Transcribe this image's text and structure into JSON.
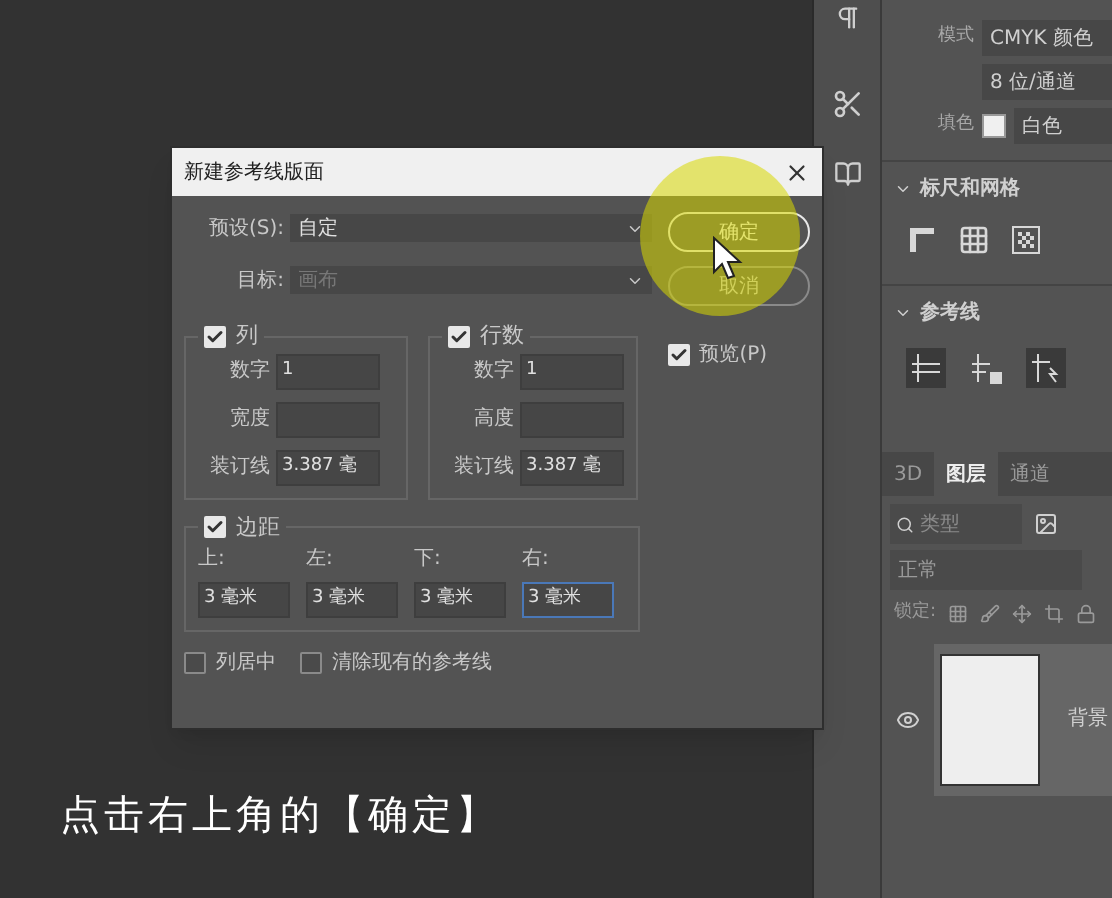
{
  "dialog": {
    "title": "新建参考线版面",
    "preset": {
      "label": "预设(S):",
      "value": "自定"
    },
    "target": {
      "label": "目标:",
      "value": "画布",
      "disabled": true
    },
    "buttons": [
      {
        "label": "确定",
        "selected": true
      },
      {
        "label": "取消",
        "selected": false
      }
    ],
    "preview": {
      "label": "预览(P)",
      "checked": true
    },
    "groups": [
      {
        "label": "列",
        "checked": true,
        "fields": [
          {
            "label": "数字",
            "value": "1"
          },
          {
            "label": "宽度"
          },
          {
            "label": "装订线",
            "value": "3.387 毫"
          }
        ]
      },
      {
        "label": "行数",
        "checked": true,
        "fields": [
          {
            "label": "数字",
            "value": "1"
          },
          {
            "label": "高度"
          },
          {
            "label": "装订线",
            "value": "3.387 毫"
          }
        ]
      }
    ],
    "margin": {
      "label": "边距",
      "checked": true,
      "fields": [
        {
          "label": "上:",
          "value": "3 毫米",
          "focused": false
        },
        {
          "label": "左:",
          "value": "3 毫米",
          "focused": false
        },
        {
          "label": "下:",
          "value": "3 毫米",
          "focused": false
        },
        {
          "label": "右:",
          "value": "3 毫米",
          "focused": true
        }
      ]
    },
    "options": [
      {
        "label": "列居中",
        "checked": false
      },
      {
        "label": "清除现有的参考线",
        "checked": false
      }
    ]
  },
  "caption": "点击右上角的【确定】",
  "panel": {
    "props": [
      {
        "label": "模式",
        "value": "CMYK 颜色"
      },
      {
        "value": "8 位/通道"
      },
      {
        "label": "填色",
        "value": "白色",
        "color": "#f0f0f0"
      }
    ],
    "sections": [
      {
        "title": "标尺和网格",
        "expanded": true
      },
      {
        "title": "参考线",
        "expanded": true
      }
    ],
    "tabs": [
      {
        "label": "3D",
        "selected": false
      },
      {
        "label": "图层",
        "selected": true
      },
      {
        "label": "通道",
        "selected": false
      }
    ],
    "filter": {
      "placeholder": "类型"
    },
    "blend": "正常",
    "lock": {
      "label": "锁定:"
    },
    "layers": [
      {
        "name": "背景",
        "visible": true
      }
    ]
  }
}
